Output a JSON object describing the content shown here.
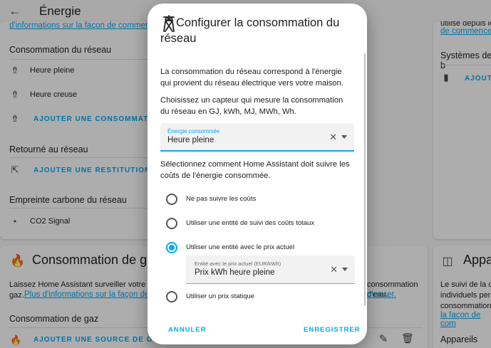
{
  "topbar": {
    "title": "Énergie"
  },
  "grid_card": {
    "top_link": "d'informations sur la façon de commencer.",
    "consumption_title": "Consommation du réseau",
    "items": [
      {
        "label": "Heure pleine",
        "icon": "transmission-tower-import-icon"
      },
      {
        "label": "Heure creuse",
        "icon": "transmission-tower-import-icon"
      }
    ],
    "add_consumption": "AJOUTER UNE CONSOMMATION",
    "return_title": "Retourné au réseau",
    "add_return": "AJOUTER UNE RESTITUTION",
    "carbon_title": "Empreinte carbone du réseau",
    "carbon_item": "CO2 Signal"
  },
  "solar_card": {
    "text": "utilisé depuis le",
    "link": "de commencer.",
    "systems_title": "Systèmes de b",
    "add_btn": "AJOUTE"
  },
  "gas_card": {
    "title": "Consommation de gaz",
    "desc_left": "Laissez Home Assistant surveiller votre con",
    "desc_left2": "gaz.",
    "link_left": "Plus d'informations sur la façon de déb",
    "desc_right": "consommation d'eau.",
    "link_right": "mencer.",
    "section": "Consommation de gaz",
    "add_source": "AJOUTER UNE SOURCE DE GAZ"
  },
  "devices_card": {
    "title": "Appa",
    "text1": "Le suivi de la co",
    "text2": "individuels perm",
    "text3": "consommation",
    "link": "la façon de com",
    "section": "Appareils"
  },
  "dialog": {
    "title": "Configurer la consommation du réseau",
    "para1": "La consommation du réseau correspond à l'énergie qui provient du réseau électrique vers votre maison.",
    "para2": "Choisissez un capteur qui mesure la consommation du réseau en GJ, kWh, MJ, MWh, Wh.",
    "sensor_field": {
      "label": "Énergie consommée",
      "value": "Heure pleine"
    },
    "para3": "Sélectionnez comment Home Assistant doit suivre les coûts de l'énergie consommée.",
    "options": [
      {
        "label": "Ne pas suivre les coûts",
        "selected": false
      },
      {
        "label": "Utiliser une entité de suivi des coûts totaux",
        "selected": false
      },
      {
        "label": "Utiliser une entité avec le prix actuel",
        "selected": true
      },
      {
        "label": "Utiliser un prix statique",
        "selected": false
      }
    ],
    "price_field": {
      "label": "Entité avec le prix actuel (EUR/kWh)",
      "value": "Prix kWh heure pleine"
    },
    "cancel": "ANNULER",
    "save": "ENREGISTRER"
  },
  "colors": {
    "accent": "#03a9f4",
    "scrim": "rgba(0,0,0,0.32)"
  }
}
